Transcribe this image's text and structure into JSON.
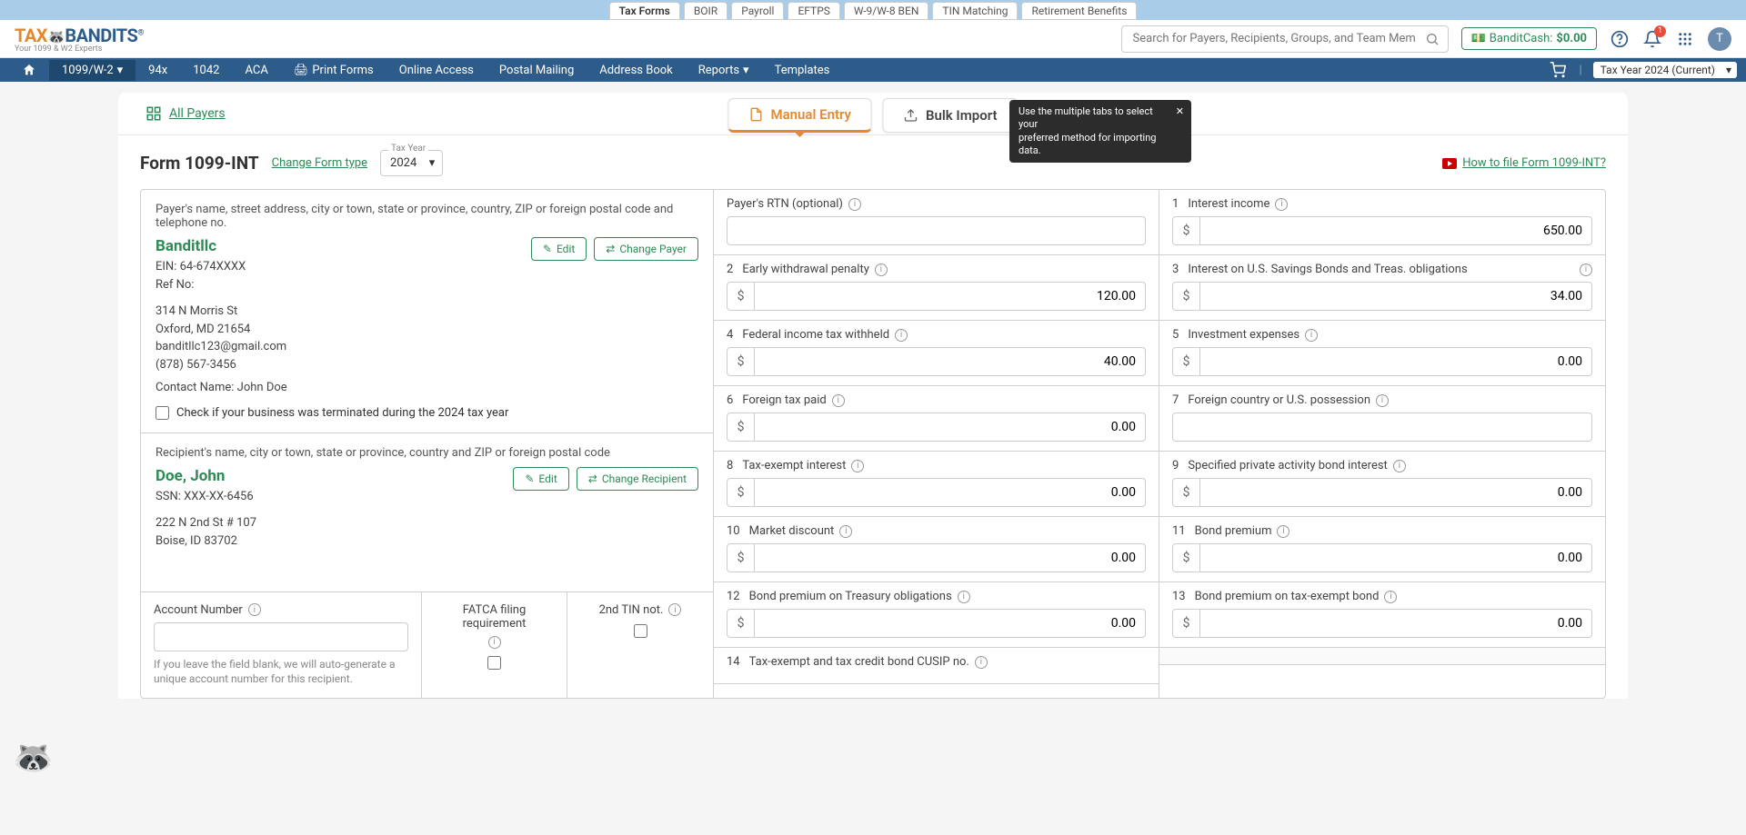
{
  "topTabs": [
    "Tax Forms",
    "BOIR",
    "Payroll",
    "EFTPS",
    "W-9/W-8 BEN",
    "TIN Matching",
    "Retirement Benefits"
  ],
  "topTabActive": "Tax Forms",
  "logo": {
    "brand": "TAX",
    "brand2": "BANDITS",
    "tag": "Your 1099 & W2 Experts"
  },
  "search": {
    "placeholder": "Search for Payers, Recipients, Groups, and Team Members"
  },
  "banditCash": {
    "label": "BanditCash:",
    "amount": "$0.00"
  },
  "notifBadge": "1",
  "avatarLetter": "T",
  "nav": [
    "1099/W-2",
    "94x",
    "1042",
    "ACA",
    "Print Forms",
    "Online Access",
    "Postal Mailing",
    "Address Book",
    "Reports",
    "Templates"
  ],
  "navActive": "1099/W-2",
  "taxYearSelect": "Tax Year 2024 (Current)",
  "allPayers": "All Payers",
  "entryTabs": {
    "manual": "Manual Entry",
    "bulk": "Bulk Import"
  },
  "tip": {
    "line1": "Use the multiple tabs to select your",
    "line2": "preferred method for importing data."
  },
  "formTitle": "Form 1099-INT",
  "changeFormType": "Change Form type",
  "taxYearBox": {
    "label": "Tax Year",
    "value": "2024"
  },
  "howTo": "How to file Form 1099-INT?",
  "payerSection": {
    "label": "Payer's name, street address, city or town, state or province, country, ZIP or foreign postal code and telephone no.",
    "name": "Banditllc",
    "ein": "EIN: 64-674XXXX",
    "ref": "Ref No:",
    "addr1": "314 N Morris St",
    "addr2": "Oxford, MD 21654",
    "email": "banditllc123@gmail.com",
    "phone": "(878) 567-3456",
    "contact": "Contact Name: John Doe",
    "terminatedCheck": "Check if your business was terminated during the 2024 tax year",
    "editBtn": "Edit",
    "changeBtn": "Change Payer"
  },
  "recipSection": {
    "label": "Recipient's name, city or town, state or province, country and ZIP or foreign postal code",
    "name": "Doe, John",
    "ssn": "SSN: XXX-XX-6456",
    "addr1": "222 N 2nd St # 107",
    "addr2": "Boise, ID 83702",
    "editBtn": "Edit",
    "changeBtn": "Change Recipient"
  },
  "bottomLeft": {
    "acctLabel": "Account Number",
    "acctHelper": "If you leave the field blank, we will auto-generate a unique account number for this recipient.",
    "fatcaLabel": "FATCA filing requirement",
    "tinLabel": "2nd TIN not."
  },
  "fields": {
    "rtn": {
      "label": "Payer's RTN (optional)",
      "value": ""
    },
    "f1": {
      "num": "1",
      "label": "Interest income",
      "value": "650.00"
    },
    "f2": {
      "num": "2",
      "label": "Early withdrawal penalty",
      "value": "120.00"
    },
    "f3": {
      "num": "3",
      "label": "Interest on U.S. Savings Bonds and Treas. obligations",
      "value": "34.00"
    },
    "f4": {
      "num": "4",
      "label": "Federal income tax withheld",
      "value": "40.00"
    },
    "f5": {
      "num": "5",
      "label": "Investment expenses",
      "value": "0.00"
    },
    "f6": {
      "num": "6",
      "label": "Foreign tax paid",
      "value": "0.00"
    },
    "f7": {
      "num": "7",
      "label": "Foreign country or U.S. possession",
      "value": ""
    },
    "f8": {
      "num": "8",
      "label": "Tax-exempt interest",
      "value": "0.00"
    },
    "f9": {
      "num": "9",
      "label": "Specified private activity bond interest",
      "value": "0.00"
    },
    "f10": {
      "num": "10",
      "label": "Market discount",
      "value": "0.00"
    },
    "f11": {
      "num": "11",
      "label": "Bond premium",
      "value": "0.00"
    },
    "f12": {
      "num": "12",
      "label": "Bond premium on Treasury obligations",
      "value": "0.00"
    },
    "f13": {
      "num": "13",
      "label": "Bond premium on tax-exempt bond",
      "value": "0.00"
    },
    "f14": {
      "num": "14",
      "label": "Tax-exempt and tax credit bond CUSIP no.",
      "value": ""
    }
  }
}
